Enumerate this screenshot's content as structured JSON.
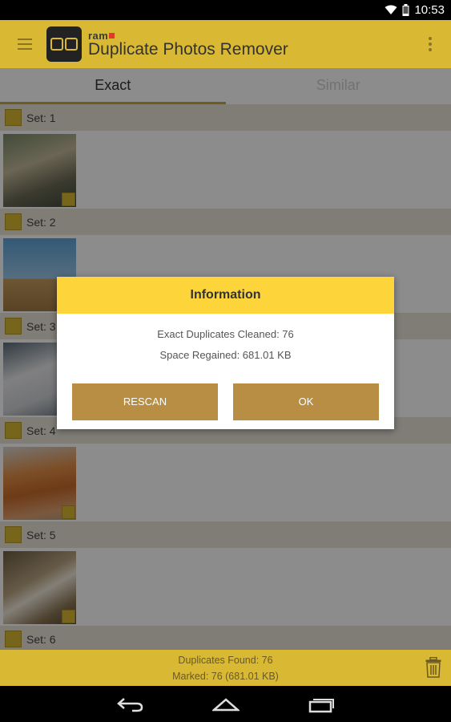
{
  "status_bar": {
    "time": "10:53"
  },
  "app_bar": {
    "brand": "ram",
    "title": "Duplicate Photos Remover"
  },
  "tabs": [
    {
      "label": "Exact",
      "active": true
    },
    {
      "label": "Similar",
      "active": false
    }
  ],
  "sets": [
    {
      "label": "Set: 1"
    },
    {
      "label": "Set: 2"
    },
    {
      "label": "Set: 3"
    },
    {
      "label": "Set: 4"
    },
    {
      "label": "Set: 5"
    },
    {
      "label": "Set: 6"
    }
  ],
  "dialog": {
    "title": "Information",
    "line1": "Exact Duplicates Cleaned: 76",
    "line2": "Space Regained: 681.01 KB",
    "rescan_label": "RESCAN",
    "ok_label": "OK"
  },
  "footer": {
    "found": "Duplicates Found: 76",
    "marked": "Marked: 76 (681.01 KB)"
  },
  "colors": {
    "accent": "#d9b834",
    "dialog_header": "#fdd53a",
    "dialog_button": "#b78e44"
  }
}
